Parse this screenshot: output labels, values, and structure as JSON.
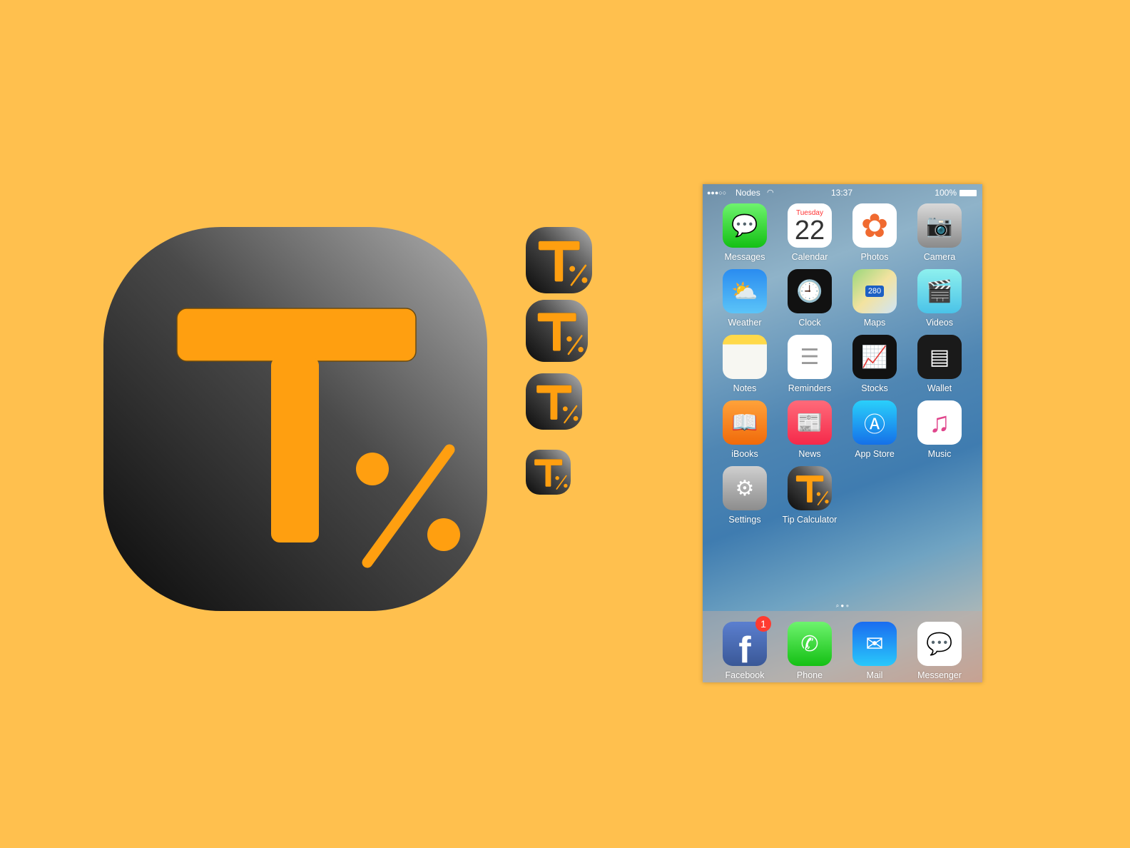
{
  "colors": {
    "background": "#FFC04E",
    "accent": "#FF9F10"
  },
  "logo": {
    "letter": "T",
    "symbol": "%"
  },
  "phone": {
    "status": {
      "signal": "●●●○○",
      "carrier": "Nodes",
      "wifi_icon": "wifi-icon",
      "time": "13:37",
      "battery": "100%"
    },
    "calendar": {
      "day": "Tuesday",
      "date": "22"
    },
    "apps": [
      {
        "label": "Messages",
        "icon": "messages-icon",
        "bg": "linear-gradient(#6ef36e,#14c014)",
        "glyph": "💬"
      },
      {
        "label": "Calendar",
        "icon": "calendar-icon",
        "bg": "#ffffff",
        "glyph": ""
      },
      {
        "label": "Photos",
        "icon": "photos-icon",
        "bg": "#ffffff",
        "glyph": "✿"
      },
      {
        "label": "Camera",
        "icon": "camera-icon",
        "bg": "linear-gradient(#d9d9d9,#8a8a8a)",
        "glyph": "📷"
      },
      {
        "label": "Weather",
        "icon": "weather-icon",
        "bg": "linear-gradient(#2a8cf0,#5bc4f8)",
        "glyph": "⛅"
      },
      {
        "label": "Clock",
        "icon": "clock-icon",
        "bg": "#111111",
        "glyph": "🕘"
      },
      {
        "label": "Maps",
        "icon": "maps-icon",
        "bg": "linear-gradient(135deg,#9ad77b,#f3e3a0,#cfe4f7)",
        "glyph": "280"
      },
      {
        "label": "Videos",
        "icon": "videos-icon",
        "bg": "linear-gradient(#8ef0ee,#4ac3e8)",
        "glyph": "🎬"
      },
      {
        "label": "Notes",
        "icon": "notes-icon",
        "bg": "linear-gradient(#ffd94a 0 22%,#f7f7f2 22%)",
        "glyph": ""
      },
      {
        "label": "Reminders",
        "icon": "reminders-icon",
        "bg": "#ffffff",
        "glyph": "☰"
      },
      {
        "label": "Stocks",
        "icon": "stocks-icon",
        "bg": "#111111",
        "glyph": "📈"
      },
      {
        "label": "Wallet",
        "icon": "wallet-icon",
        "bg": "#1a1a1a",
        "glyph": "▤"
      },
      {
        "label": "iBooks",
        "icon": "ibooks-icon",
        "bg": "linear-gradient(#ffa23a,#f06a0a)",
        "glyph": "📖"
      },
      {
        "label": "News",
        "icon": "news-icon",
        "bg": "linear-gradient(#ff6b7a,#f5294a)",
        "glyph": "📰"
      },
      {
        "label": "App Store",
        "icon": "app-store-icon",
        "bg": "linear-gradient(#2ad0fb,#1570e8)",
        "glyph": "Ⓐ"
      },
      {
        "label": "Music",
        "icon": "music-icon",
        "bg": "#ffffff",
        "glyph": "♫"
      },
      {
        "label": "Settings",
        "icon": "settings-icon",
        "bg": "linear-gradient(#cfcfcf,#8c8c8c)",
        "glyph": "⚙"
      },
      {
        "label": "Tip Calculator",
        "icon": "tip-calculator-icon",
        "bg": "tlogo",
        "glyph": ""
      }
    ],
    "dock": [
      {
        "label": "Facebook",
        "icon": "facebook-icon",
        "bg": "linear-gradient(#5b7fcf,#3a5897)",
        "glyph": "f",
        "badge": "1"
      },
      {
        "label": "Phone",
        "icon": "phone-icon",
        "bg": "linear-gradient(#6ef36e,#14c014)",
        "glyph": "✆"
      },
      {
        "label": "Mail",
        "icon": "mail-icon",
        "bg": "linear-gradient(#1a6cf0,#29c8fb)",
        "glyph": "✉"
      },
      {
        "label": "Messenger",
        "icon": "messenger-icon",
        "bg": "#ffffff",
        "glyph": "💬"
      }
    ]
  }
}
